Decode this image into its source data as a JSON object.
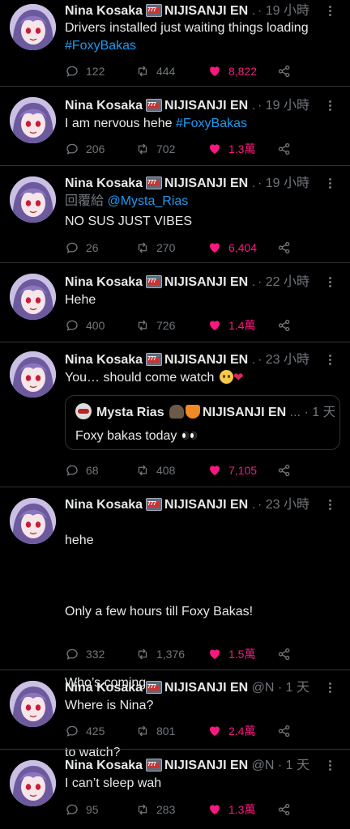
{
  "author": {
    "name": "Nina Kosaka",
    "org": "NIJISANJI EN",
    "handle_trunc": "@N..."
  },
  "colors": {
    "background": "#000000",
    "link": "#1d9bf0",
    "like": "#f91880",
    "muted": "#71767b"
  },
  "icons": [
    "reply-icon",
    "retweet-icon",
    "heart-icon",
    "share-icon",
    "more-icon",
    "slot-machine-emoji"
  ],
  "tweets": [
    {
      "time": "19 小時",
      "text": "Drivers installed just waiting things loading",
      "hashtag": "#FoxyBakas",
      "replies": "122",
      "retweets": "444",
      "likes": "8,822"
    },
    {
      "time": "19 小時",
      "text": "I am nervous hehe",
      "hashtag": "#FoxyBakas",
      "replies": "206",
      "retweets": "702",
      "likes": "1.3萬"
    },
    {
      "time": "19 小時",
      "reply_prefix": "回覆給",
      "reply_handle": "@Mysta_Rias",
      "text": "NO SUS JUST VIBES",
      "replies": "26",
      "retweets": "270",
      "likes": "6,404"
    },
    {
      "time": "22 小時",
      "text": "Hehe",
      "replies": "400",
      "retweets": "726",
      "likes": "1.4萬"
    },
    {
      "time": "23 小時",
      "text": "You… should come watch",
      "quote": {
        "name": "Mysta Rias",
        "org": "NIJISANJI EN",
        "ellipsis": "...",
        "time": "1 天",
        "text": "Foxy bakas today"
      },
      "replies": "68",
      "retweets": "408",
      "likes": "7,105"
    },
    {
      "time": "23 小時",
      "text_lines": [
        "hehe",
        "",
        "Only a few hours till Foxy Bakas!",
        "",
        "Who’s coming",
        "",
        "to watch?"
      ],
      "replies": "332",
      "retweets": "1,376",
      "likes": "1.5萬"
    },
    {
      "time": "1 天",
      "text": "Where is Nina?",
      "replies": "425",
      "retweets": "801",
      "likes": "2.4萬"
    },
    {
      "time": "1 天",
      "text": "I can’t sleep wah",
      "replies": "95",
      "retweets": "283",
      "likes": "1.3萬"
    }
  ]
}
